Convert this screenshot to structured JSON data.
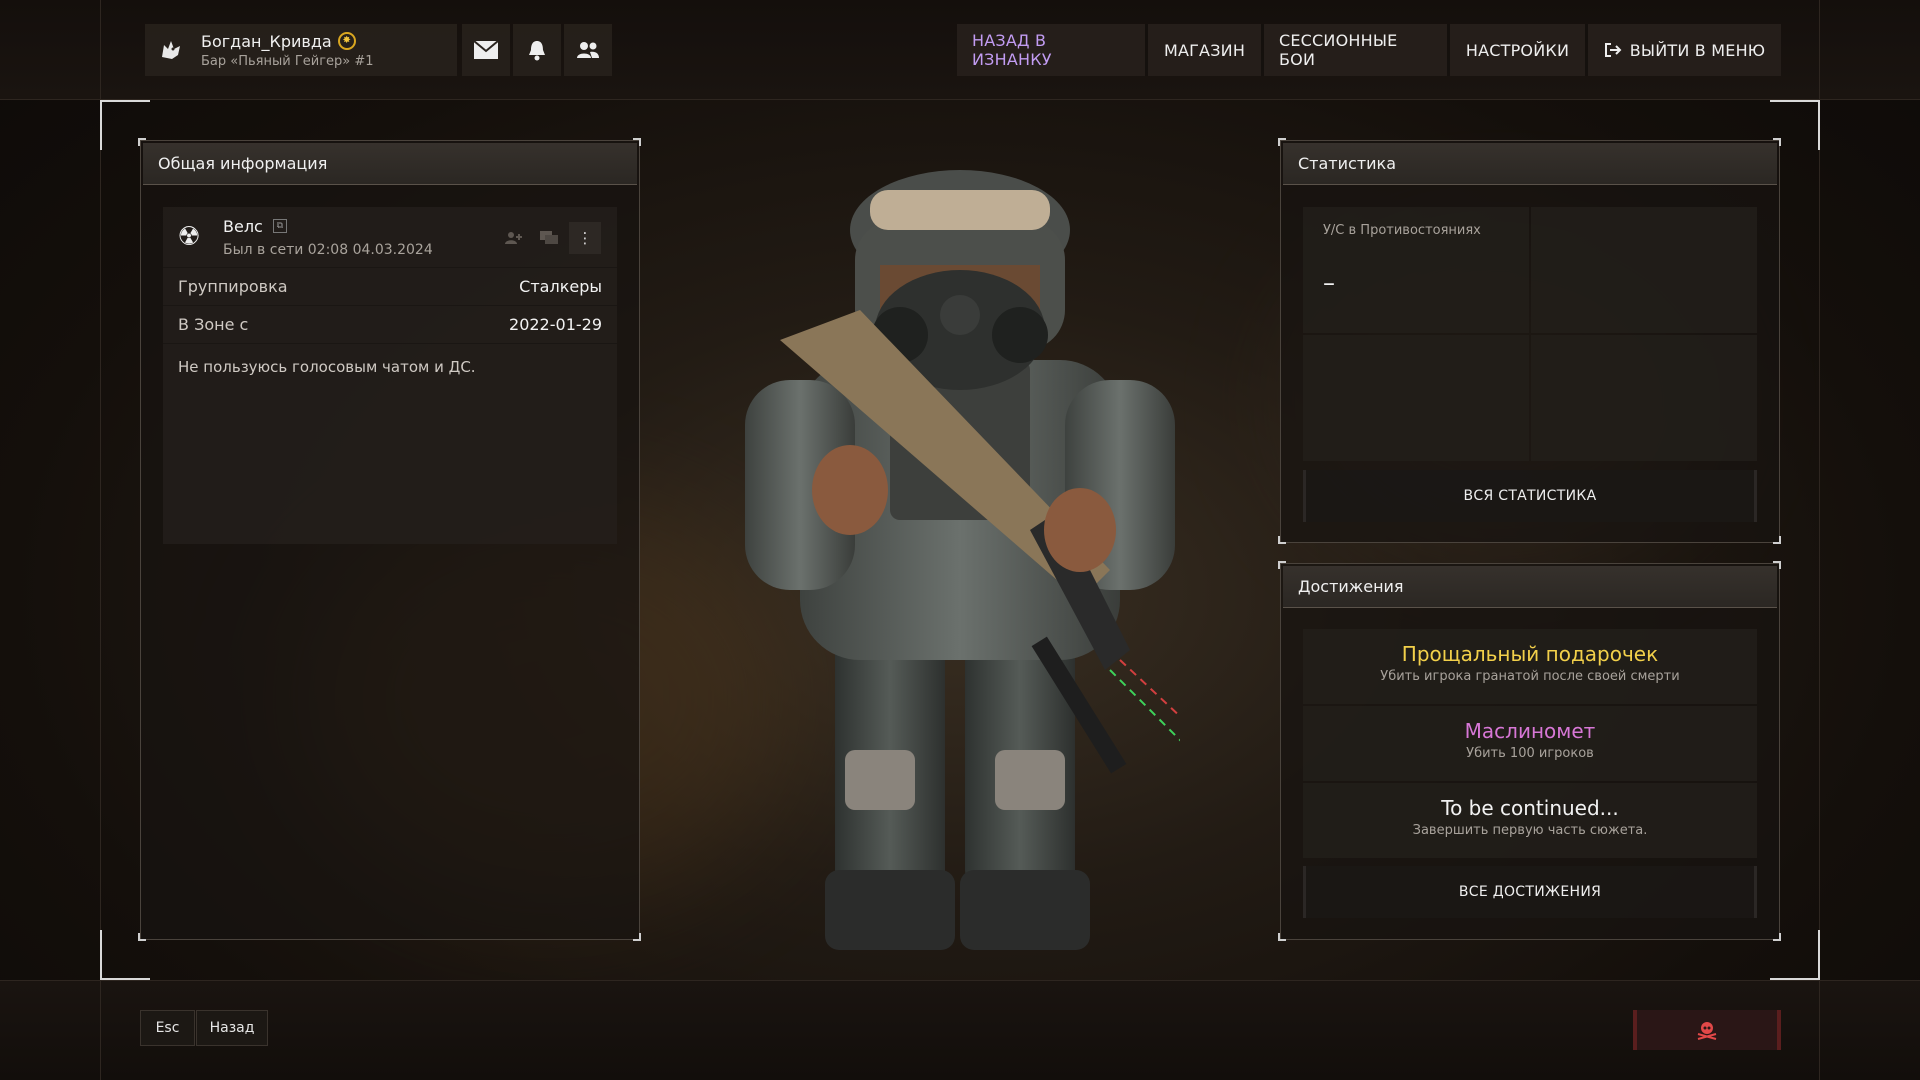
{
  "topbar": {
    "player": {
      "name": "Богдан_Кривда",
      "subtitle": "Бар «Пьяный Гейгер» #1",
      "emblem_icon": "wolf-head-icon",
      "badge_icon": "rank-badge-icon"
    },
    "icons": [
      "mail-icon",
      "bell-icon",
      "friends-icon"
    ],
    "nav": [
      {
        "label": "НАЗАД В ИЗНАНКУ",
        "active": true
      },
      {
        "label": "МАГАЗИН",
        "active": false
      },
      {
        "label": "СЕССИОННЫЕ БОИ",
        "active": false
      },
      {
        "label": "НАСТРОЙКИ",
        "active": false
      },
      {
        "label": "ВЫЙТИ В МЕНЮ",
        "active": false,
        "icon": "logout-icon"
      }
    ]
  },
  "info_panel": {
    "title": "Общая информация",
    "profile": {
      "name": "Велс",
      "last_seen": "Был в сети 02:08 04.03.2024",
      "icon": "radiation-icon"
    },
    "rows": [
      {
        "label": "Группировка",
        "value": "Сталкеры"
      },
      {
        "label": "В Зоне с",
        "value": "2022-01-29"
      }
    ],
    "about": "Не пользуюсь голосовым чатом и ДС."
  },
  "stats_panel": {
    "title": "Статистика",
    "cells": [
      {
        "title": "У/С в Противостояниях",
        "value": "–"
      },
      {
        "title": "",
        "value": ""
      },
      {
        "title": "",
        "value": ""
      },
      {
        "title": "",
        "value": ""
      }
    ],
    "all_button": "ВСЯ СТАТИСТИКА"
  },
  "achievements_panel": {
    "title": "Достижения",
    "items": [
      {
        "title": "Прощальный подарочек",
        "desc": "Убить игрока гранатой после своей смерти",
        "color": "#f2d04a"
      },
      {
        "title": "Маслиномет",
        "desc": "Убить 100 игроков",
        "color": "#d777d6"
      },
      {
        "title": "To be continued...",
        "desc": "Завершить первую часть сюжета.",
        "color": "#f2f2f2"
      }
    ],
    "all_button": "ВСЕ ДОСТИЖЕНИЯ"
  },
  "bottombar": {
    "esc_key": "Esc",
    "back_label": "Назад",
    "danger_icon": "skull-icon"
  },
  "colors": {
    "accent_active": "#c29cf2",
    "danger": "#e24848"
  }
}
